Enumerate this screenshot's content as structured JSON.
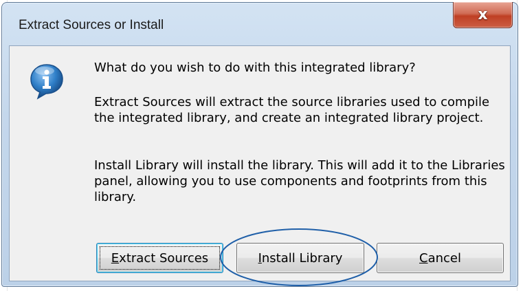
{
  "dialog": {
    "title": "Extract Sources or Install",
    "close_glyph": "x",
    "icon": "information-icon",
    "question": "What do you wish to do with this integrated library?",
    "extract_description": "Extract Sources will extract the source libraries used to compile the integrated library, and create an integrated library project.",
    "install_description": "Install Library will install the library. This will add it to the Libraries panel, allowing you to use components and footprints from this library."
  },
  "buttons": {
    "extract": {
      "mnemonic": "E",
      "rest": "xtract Sources"
    },
    "install": {
      "mnemonic": "I",
      "rest": "nstall Library"
    },
    "cancel": {
      "mnemonic": "C",
      "rest": "ancel"
    }
  },
  "colors": {
    "annotation_ellipse": "#1f5fa8",
    "close_button": "#c74b32",
    "info_icon": "#2a6fb5"
  }
}
